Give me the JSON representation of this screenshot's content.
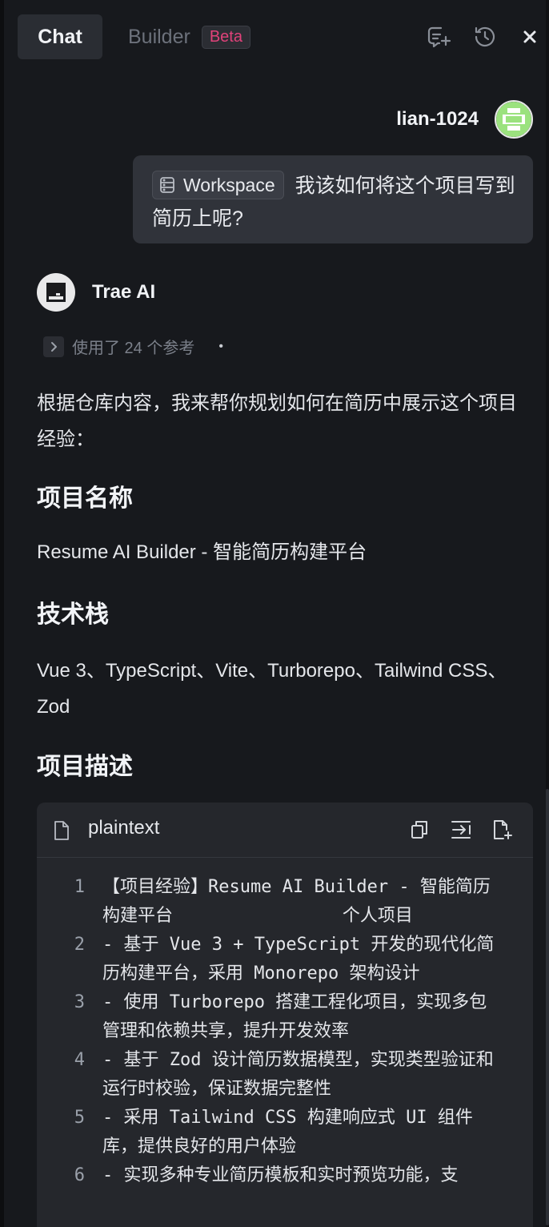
{
  "header": {
    "tabs": [
      {
        "label": "Chat",
        "active": true
      },
      {
        "label": "Builder",
        "active": false,
        "badge": "Beta"
      }
    ],
    "icons": [
      "new-chat-icon",
      "history-icon",
      "close-icon"
    ]
  },
  "user_message": {
    "username": "lian-1024",
    "chip_label": "Workspace",
    "text": "我该如何将这个项目写到简历上呢?"
  },
  "ai_message": {
    "name": "Trae AI",
    "refs_text": "使用了 24 个参考",
    "refs_dot": "•",
    "intro": "根据仓库内容，我来帮你规划如何在简历中展示这个项目经验：",
    "sections": [
      {
        "heading": "项目名称",
        "body": "Resume AI Builder - 智能简历构建平台"
      },
      {
        "heading": "技术栈",
        "body": "Vue 3、TypeScript、Vite、Turborepo、Tailwind CSS、Zod"
      },
      {
        "heading": "项目描述",
        "body": ""
      }
    ],
    "code_block": {
      "language": "plaintext",
      "lines": [
        {
          "num": "1",
          "text": "【项目经验】Resume AI Builder - 智能简历构建平台                个人项目"
        },
        {
          "num": "2",
          "text": "- 基于 Vue 3 + TypeScript 开发的现代化简历构建平台，采用 Monorepo 架构设计"
        },
        {
          "num": "3",
          "text": "- 使用 Turborepo 搭建工程化项目，实现多包管理和依赖共享，提升开发效率"
        },
        {
          "num": "4",
          "text": "- 基于 Zod 设计简历数据模型，实现类型验证和运行时校验，保证数据完整性"
        },
        {
          "num": "5",
          "text": "- 采用 Tailwind CSS 构建响应式 UI 组件库，提供良好的用户体验"
        },
        {
          "num": "6",
          "text": "- 实现多种专业简历模板和实时预览功能，支"
        }
      ]
    }
  },
  "colors": {
    "background": "#17191d",
    "beta_badge": "#e0427a",
    "avatar_green": "#9be27e"
  }
}
